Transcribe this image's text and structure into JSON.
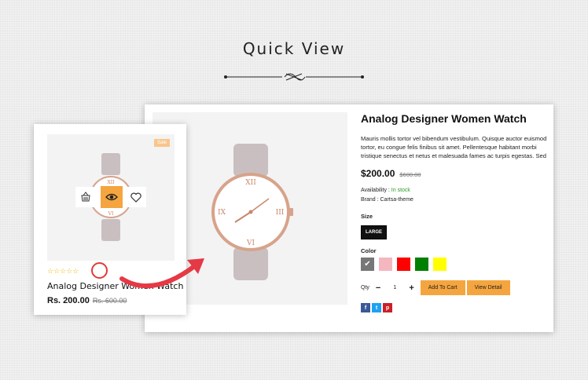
{
  "header": {
    "title": "Quick View"
  },
  "quick_view": {
    "title": "Analog Designer Women Watch",
    "description": [
      "Mauris mollis tortor vel bibendum vestibulum. Quisque auctor euismod",
      "tortor, eu congue felis finibus sit amet. Pellentesque habitant morbi",
      "tristique senectus et netus et malesuada fames ac turpis egestas. Sed"
    ],
    "price": "$200.00",
    "old_price": "$600.00",
    "availability_label": "Availability : ",
    "availability_value": "In stock",
    "brand": "Brand : Cartsa-theme",
    "size_label": "Size",
    "size_value": "LARGE",
    "color_label": "Color",
    "colors": [
      "#777777",
      "#f4b7c0",
      "#ff0000",
      "#008000",
      "#ffff00"
    ],
    "selected_color_mark": "✔",
    "qty_label": "Qty",
    "qty_minus": "−",
    "qty_value": "1",
    "qty_plus": "+",
    "add_to_cart": "Add To Cart",
    "view_detail": "View Detail",
    "social": [
      {
        "icon": "facebook-icon",
        "glyph": "f",
        "color": "#3b5998"
      },
      {
        "icon": "twitter-icon",
        "glyph": "t",
        "color": "#1da1f2"
      },
      {
        "icon": "pinterest-icon",
        "glyph": "p",
        "color": "#cb2027"
      }
    ]
  },
  "product_card": {
    "badge": "Sale",
    "stars": "☆☆☆☆☆",
    "title": "Analog Designer Women Watch",
    "price": "Rs. 200.00",
    "old_price": "Rs. 600.00",
    "icons": [
      "basket-icon",
      "eye-icon",
      "heart-icon"
    ]
  },
  "theme": {
    "accent": "#f5a53f",
    "arrow": "#e53945"
  }
}
